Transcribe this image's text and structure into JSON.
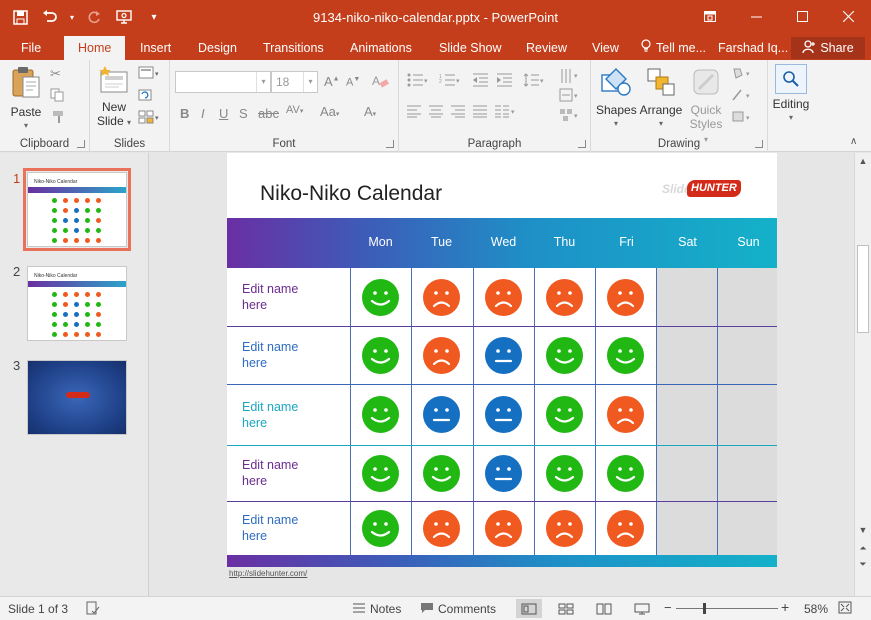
{
  "app": {
    "title": "9134-niko-niko-calendar.pptx - PowerPoint",
    "brand_color": "#c43e1c"
  },
  "qat": {
    "save": "save-icon",
    "undo": "undo-icon",
    "redo": "redo-icon",
    "present": "present-icon",
    "customize": "customize-icon"
  },
  "window": {
    "restore": "restore-icon",
    "minimize": "minimize-icon",
    "maximize": "maximize-icon",
    "close": "close-icon"
  },
  "tabs": [
    {
      "label": "File"
    },
    {
      "label": "Home"
    },
    {
      "label": "Insert"
    },
    {
      "label": "Design"
    },
    {
      "label": "Transitions"
    },
    {
      "label": "Animations"
    },
    {
      "label": "Slide Show"
    },
    {
      "label": "Review"
    },
    {
      "label": "View"
    }
  ],
  "active_tab": "Home",
  "tell_me": "Tell me...",
  "user": "Farshad Iq...",
  "share": "Share",
  "ribbon": {
    "clipboard": {
      "label": "Clipboard",
      "paste": "Paste"
    },
    "slides": {
      "label": "Slides",
      "new_slide_1": "New",
      "new_slide_2": "Slide"
    },
    "font": {
      "label": "Font",
      "font_name": "",
      "font_size": "18"
    },
    "paragraph": {
      "label": "Paragraph"
    },
    "drawing": {
      "label": "Drawing",
      "shapes": "Shapes",
      "arrange": "Arrange",
      "quick_styles_1": "Quick",
      "quick_styles_2": "Styles"
    },
    "editing": {
      "label": "Editing"
    }
  },
  "thumbnails": [
    {
      "num": "1",
      "title": "Niko-Niko Calendar"
    },
    {
      "num": "2",
      "title": "Niko-Niko Calendar"
    },
    {
      "num": "3",
      "title": ""
    }
  ],
  "slide": {
    "title": "Niko-Niko Calendar",
    "logo_a": "Slide",
    "logo_b": "HUNTER",
    "days": [
      "Mon",
      "Tue",
      "Wed",
      "Thu",
      "Fri",
      "Sat",
      "Sun"
    ],
    "rows": [
      {
        "name_1": "Edit name",
        "name_2": "here",
        "color": "#6b2c91",
        "line": "#5b3f9e",
        "faces": [
          "happy",
          "sad",
          "sad",
          "sad",
          "sad"
        ]
      },
      {
        "name_1": "Edit name",
        "name_2": "here",
        "color": "#2e6cc2",
        "line": "#3a64b5",
        "faces": [
          "happy",
          "sad",
          "neutral",
          "happy",
          "happy"
        ]
      },
      {
        "name_1": "Edit name",
        "name_2": "here",
        "color": "#1aa7c0",
        "line": "#1aa7c0",
        "faces": [
          "happy",
          "neutral",
          "neutral",
          "happy",
          "sad"
        ]
      },
      {
        "name_1": "Edit name",
        "name_2": "here",
        "color": "#6b2c91",
        "line": "#5b3f9e",
        "faces": [
          "happy",
          "happy",
          "neutral",
          "happy",
          "happy"
        ]
      },
      {
        "name_1": "Edit name",
        "name_2": "here",
        "color": "#2e6cc2",
        "line": "#3a64b5",
        "faces": [
          "happy",
          "sad",
          "sad",
          "sad",
          "sad"
        ]
      }
    ],
    "face_colors": {
      "happy": "#22b814",
      "sad": "#f05a20",
      "neutral": "#1670c2"
    },
    "source_url": "http://slidehunter.com/"
  },
  "status": {
    "slide_info": "Slide 1 of 3",
    "notes": "Notes",
    "comments": "Comments",
    "zoom": "58%",
    "zoom_fraction": 0.27
  }
}
